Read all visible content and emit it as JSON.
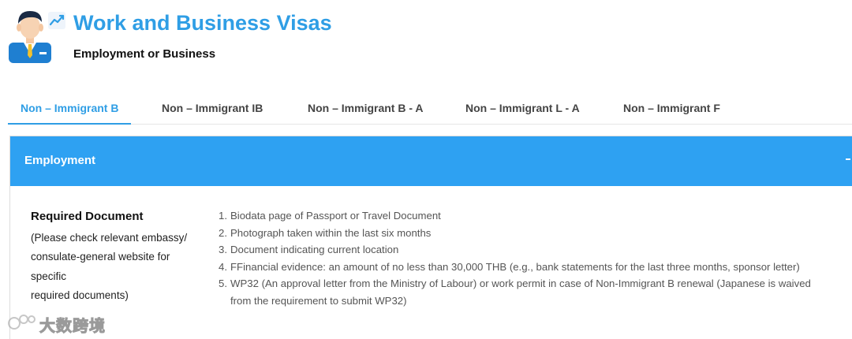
{
  "header": {
    "title": "Work and Business Visas",
    "subtitle": "Employment or Business",
    "avatar_icon": "businessman-avatar-icon",
    "trend_icon": "trend-chart-icon"
  },
  "tabs": [
    {
      "label": "Non – Immigrant B",
      "active": true
    },
    {
      "label": "Non – Immigrant IB",
      "active": false
    },
    {
      "label": "Non – Immigrant B - A",
      "active": false
    },
    {
      "label": "Non – Immigrant L - A",
      "active": false
    },
    {
      "label": "Non – Immigrant F",
      "active": false
    }
  ],
  "panel": {
    "title": "Employment",
    "accent_color": "#2ea1f2",
    "required_label": "Required Document",
    "required_note": [
      "(Please check relevant embassy/",
      "consulate-general website for",
      "specific",
      "required documents)"
    ],
    "documents": [
      {
        "num": "1.",
        "text": "Biodata page of Passport or Travel Document"
      },
      {
        "num": "2.",
        "text": "Photograph taken within the last six months"
      },
      {
        "num": "3.",
        "text": "Document indicating current location"
      },
      {
        "num": "4.",
        "text": "FFinancial evidence: an amount of no less than 30,000 THB (e.g., bank statements for the last three months, sponsor letter)"
      },
      {
        "num": "5.",
        "text": "WP32 (An approval letter from the Ministry of Labour) or work permit in case of Non-Immigrant B renewal (Japanese is waived",
        "text2": "from the requirement to submit WP32)"
      }
    ]
  },
  "watermark": {
    "text": "大数跨境"
  }
}
